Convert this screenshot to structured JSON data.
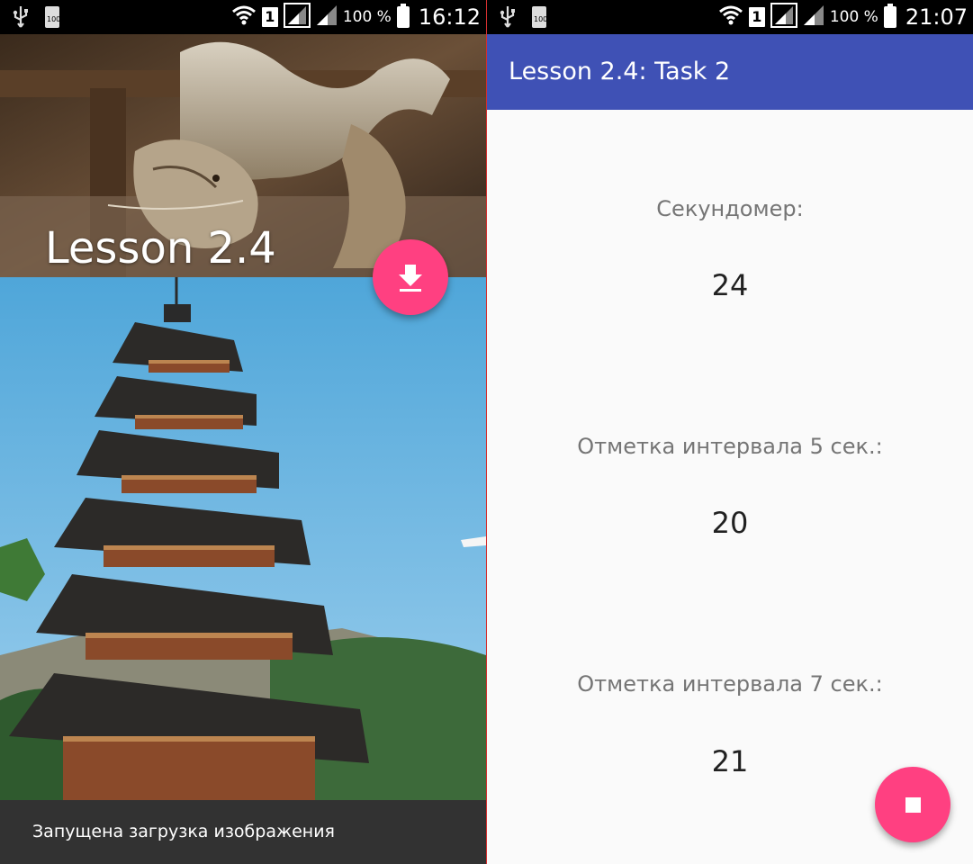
{
  "left": {
    "status": {
      "battery_small_label": "100",
      "sim": "1",
      "battery_pct": "100 %",
      "time": "16:12"
    },
    "hero_title": "Lesson 2.4",
    "fab_icon": "download-icon",
    "snackbar_text": "Запущена загрузка изображения"
  },
  "right": {
    "status": {
      "battery_small_label": "100",
      "sim": "1",
      "battery_pct": "100 %",
      "time": "21:07"
    },
    "toolbar_title": "Lesson 2.4: Task 2",
    "stopwatch_label": "Секундомер:",
    "stopwatch_value": "24",
    "interval5_label": "Отметка интервала 5 сек.:",
    "interval5_value": "20",
    "interval7_label": "Отметка интервала 7 сек.:",
    "interval7_value": "21",
    "fab_icon": "stop-icon"
  },
  "colors": {
    "primary": "#3f51b5",
    "accent": "#ff4081",
    "snackbar": "#323232"
  }
}
